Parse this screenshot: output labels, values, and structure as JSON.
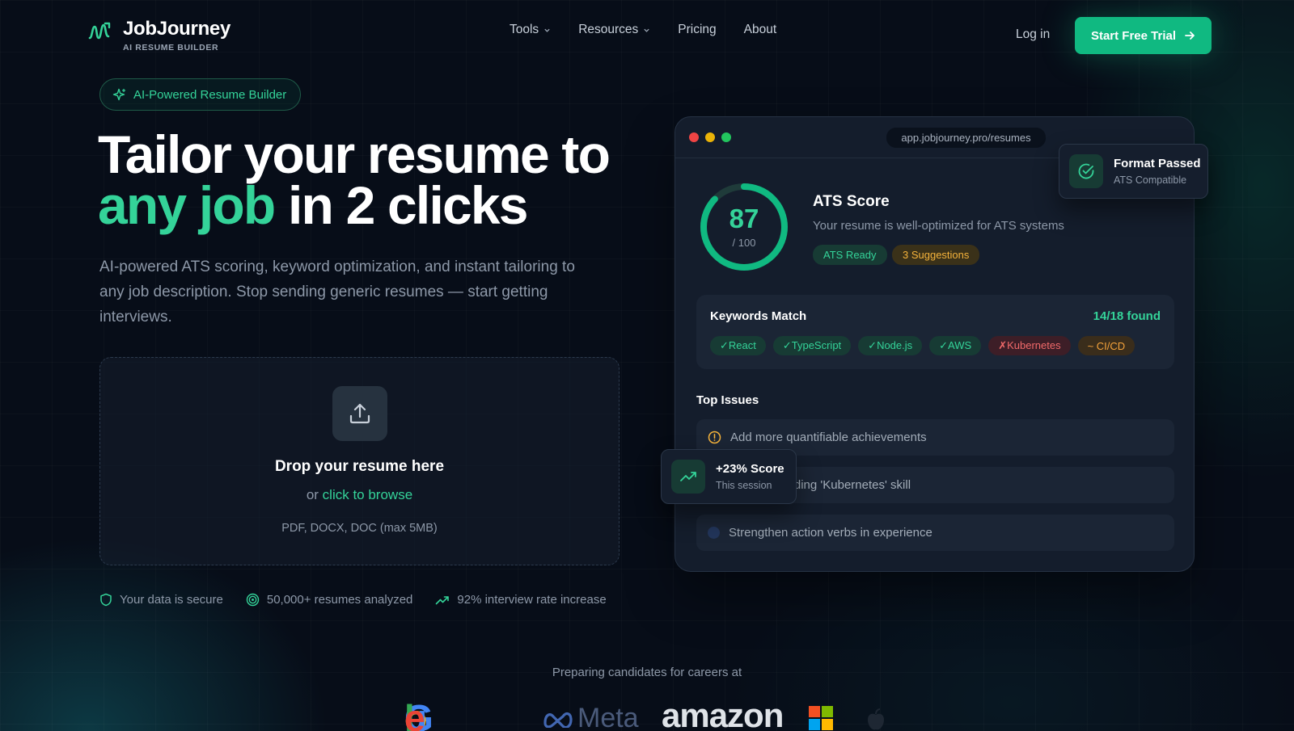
{
  "brand": {
    "name": "JobJourney",
    "tagline": "AI RESUME BUILDER"
  },
  "nav": {
    "items": [
      {
        "label": "Tools",
        "dropdown": true
      },
      {
        "label": "Resources",
        "dropdown": true
      },
      {
        "label": "Pricing",
        "dropdown": false
      },
      {
        "label": "About",
        "dropdown": false
      }
    ]
  },
  "header": {
    "login": "Log in",
    "cta": "Start Free Trial"
  },
  "hero": {
    "badge": "AI-Powered Resume Builder",
    "headline_line1": "Tailor your resume to",
    "headline_accent": "any job",
    "headline_line2_rest": " in 2 clicks",
    "subtitle": "AI-powered ATS scoring, keyword optimization, and instant tailoring to any job description. Stop sending generic resumes — start getting interviews."
  },
  "upload": {
    "title": "Drop your resume here",
    "or": "or ",
    "browse": "click to browse",
    "formats": "PDF, DOCX, DOC (max 5MB)"
  },
  "trust": [
    {
      "icon": "shield-icon",
      "label": "Your data is secure"
    },
    {
      "icon": "target-icon",
      "label": "50,000+ resumes analyzed"
    },
    {
      "icon": "trending-up-icon",
      "label": "92% interview rate increase"
    }
  ],
  "companies": {
    "caption": "Preparing candidates for careers at",
    "names": [
      "Google",
      "Meta",
      "amazon",
      "Microsoft",
      "Apple"
    ]
  },
  "app_preview": {
    "url": "app.jobjourney.pro/resumes",
    "ats": {
      "score": "87",
      "max": "/ 100",
      "score_fraction": 0.87,
      "title": "ATS Score",
      "description": "Your resume is well-optimized for ATS systems",
      "pill_ready": "ATS Ready",
      "pill_suggestions": "3 Suggestions"
    },
    "keywords": {
      "title": "Keywords Match",
      "count": "14/18 found",
      "tags": [
        {
          "label": "✓React",
          "status": "ok"
        },
        {
          "label": "✓TypeScript",
          "status": "ok"
        },
        {
          "label": "✓Node.js",
          "status": "ok"
        },
        {
          "label": "✓AWS",
          "status": "ok"
        },
        {
          "label": "✗Kubernetes",
          "status": "missing"
        },
        {
          "label": "~ CI/CD",
          "status": "partial"
        }
      ]
    },
    "issues": {
      "title": "Top Issues",
      "items": [
        {
          "label": "Add more quantifiable achievements",
          "severity": "warning"
        },
        {
          "label": "Consider adding 'Kubernetes' skill",
          "severity": "info"
        },
        {
          "label": "Strengthen action verbs in experience",
          "severity": "minor"
        }
      ]
    }
  },
  "float_format": {
    "title": "Format Passed",
    "subtitle": "ATS Compatible"
  },
  "float_score": {
    "title": "+23% Score",
    "subtitle": "This session"
  },
  "colors": {
    "accent": "#10b981",
    "accent_text": "#34d399",
    "warning": "#f5b33b",
    "danger": "#f16a6a",
    "background": "#070d18"
  }
}
